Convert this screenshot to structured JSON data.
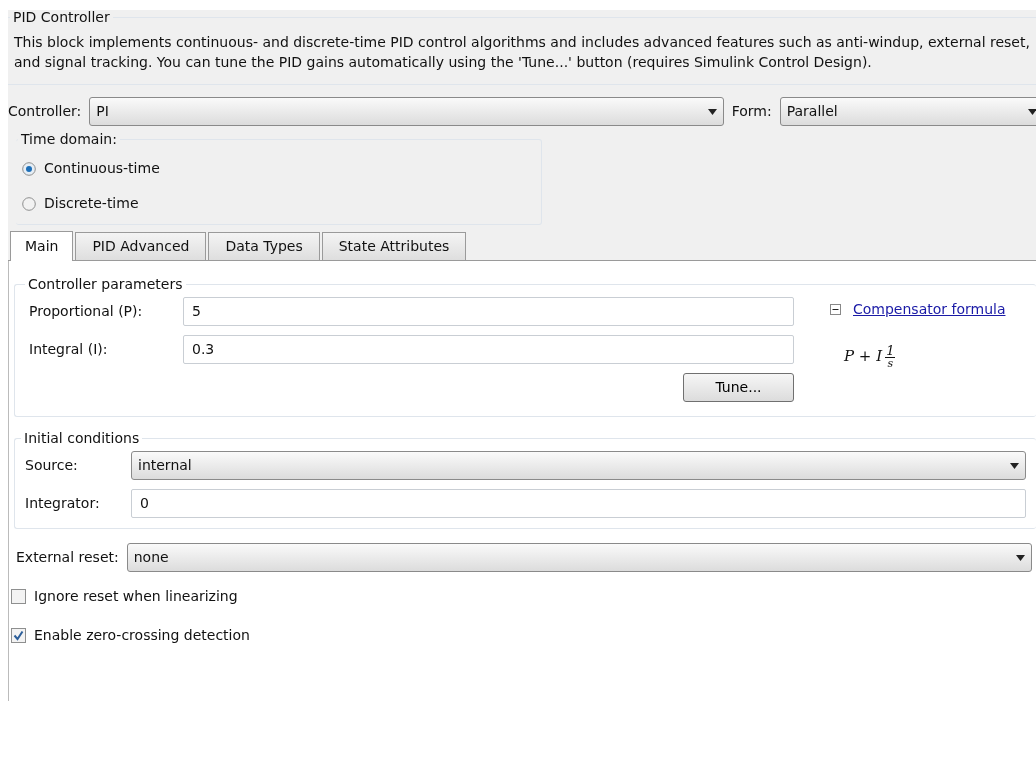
{
  "block": {
    "title": "PID Controller",
    "description": "This block implements continuous- and discrete-time PID control algorithms and includes advanced features such as anti-windup, external reset, and signal tracking. You can tune the PID gains automatically using the 'Tune...' button (requires Simulink Control Design)."
  },
  "controller": {
    "label": "Controller:",
    "value": "PI"
  },
  "form": {
    "label": "Form:",
    "value": "Parallel"
  },
  "time_domain": {
    "title": "Time domain:",
    "options": [
      {
        "label": "Continuous-time",
        "selected": true
      },
      {
        "label": "Discrete-time",
        "selected": false
      }
    ]
  },
  "tabs": [
    {
      "label": "Main",
      "selected": true
    },
    {
      "label": "PID Advanced",
      "selected": false
    },
    {
      "label": "Data Types",
      "selected": false
    },
    {
      "label": "State Attributes",
      "selected": false
    }
  ],
  "controller_parameters": {
    "title": "Controller parameters",
    "fields": [
      {
        "label": "Proportional (P):",
        "value": "5"
      },
      {
        "label": "Integral (I):",
        "value": "0.3"
      }
    ],
    "tune_button": "Tune...",
    "formula_link": {
      "label": "Compensator formula",
      "expanded": true
    },
    "formula": {
      "terms": "P + I",
      "numerator": "1",
      "denominator": "s"
    }
  },
  "initial_conditions": {
    "title": "Initial conditions",
    "source": {
      "label": "Source:",
      "value": "internal"
    },
    "integrator": {
      "label": "Integrator:",
      "value": "0"
    }
  },
  "external_reset": {
    "label": "External reset:",
    "value": "none"
  },
  "options": [
    {
      "label": "Ignore reset when linearizing",
      "checked": false
    },
    {
      "label": "Enable zero-crossing detection",
      "checked": true
    }
  ]
}
